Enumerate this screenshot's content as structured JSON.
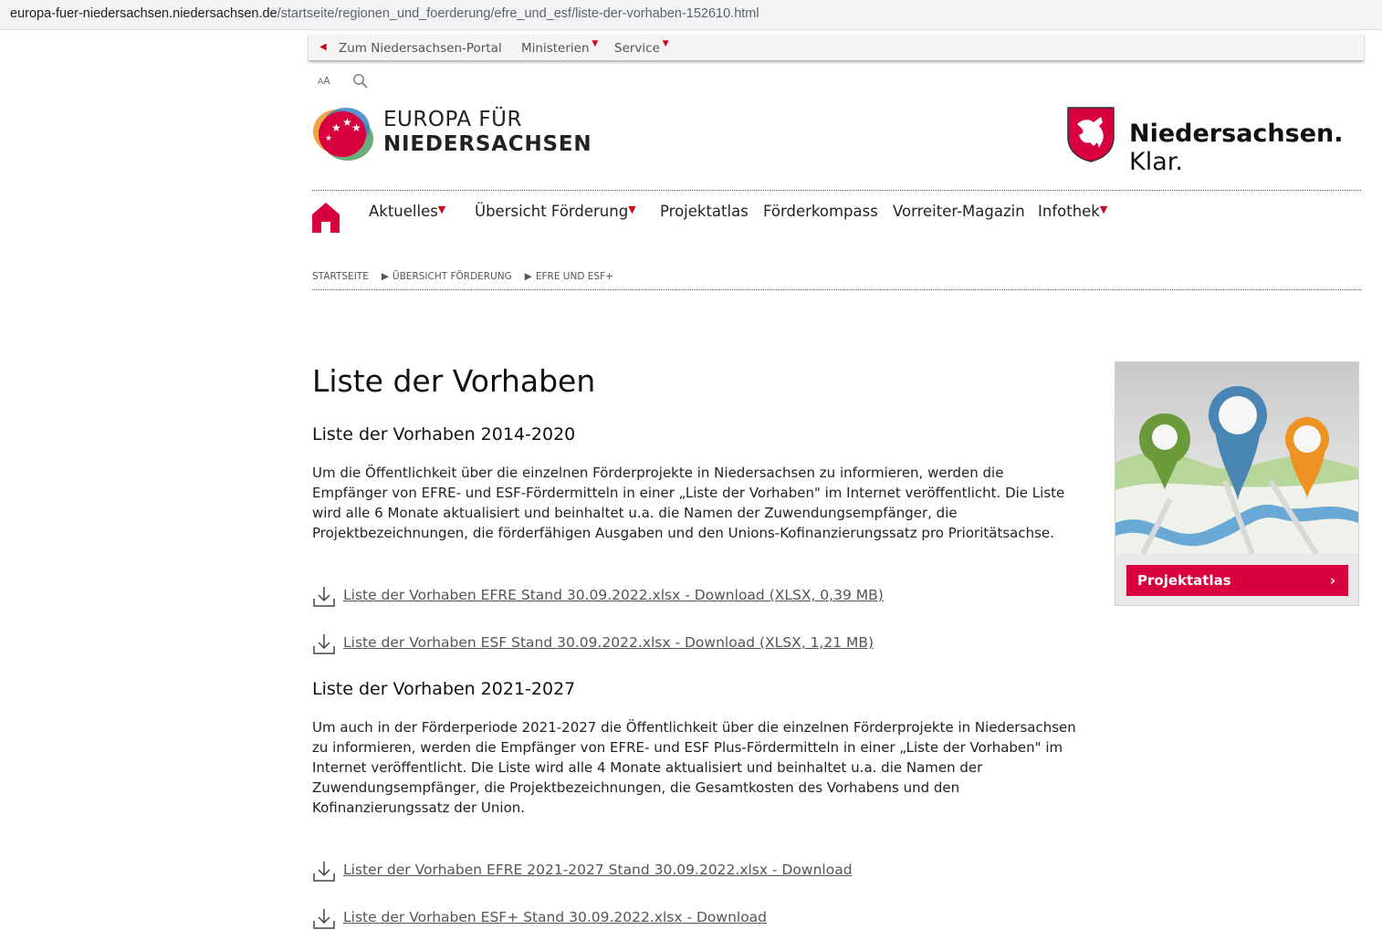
{
  "browser": {
    "url_host": "europa-fuer-niedersachsen.niedersachsen.de",
    "url_path": "/startseite/regionen_und_foerderung/efre_und_esf/liste-der-vorhaben-152610.html"
  },
  "topbar": {
    "portal_link": "Zum Niedersachsen-Portal",
    "ministerien": "Ministerien",
    "service": "Service"
  },
  "tools": {
    "font_size_label": "AA"
  },
  "eu_logo": {
    "line1": "EUROPA FÜR",
    "line2": "NIEDERSACHSEN"
  },
  "ns_logo": {
    "bold": "Niedersachsen.",
    "light": "Klar."
  },
  "nav": {
    "items": [
      {
        "label": "Aktuelles",
        "has_menu": true
      },
      {
        "label": "Übersicht Förderung",
        "has_menu": true
      },
      {
        "label": "Projektatlas",
        "has_menu": false
      },
      {
        "label": "Förderkompass",
        "has_menu": false
      },
      {
        "label": "Vorreiter-Magazin",
        "has_menu": false
      },
      {
        "label": "Infothek",
        "has_menu": true
      }
    ]
  },
  "breadcrumb": [
    "STARTSEITE",
    "ÜBERSICHT FÖRDERUNG",
    "EFRE UND ESF+"
  ],
  "main": {
    "title": "Liste der Vorhaben",
    "sections": [
      {
        "heading": "Liste der Vorhaben 2014-2020",
        "paragraph_lines": [
          "Um die Öffentlichkeit über die einzelnen Förderprojekte in Niedersachsen zu informieren, werden die",
          "Empfänger von EFRE- und ESF-Fördermitteln in einer „Liste der Vorhaben\" im Internet veröffentlicht. Die Liste",
          "wird alle 6 Monate aktualisiert und beinhaltet u.a. die Namen der Zuwendungsempfänger, die",
          "Projektbezeichnungen, die förderfähigen Ausgaben und den Unions-Kofinanzierungssatz pro Prioritätsachse."
        ],
        "downloads": [
          "Liste der Vorhaben EFRE Stand 30.09.2022.xlsx - Download (XLSX, 0,39 MB)",
          "Liste der Vorhaben ESF Stand 30.09.2022.xlsx - Download (XLSX, 1,21 MB)"
        ]
      },
      {
        "heading": "Liste der Vorhaben 2021-2027",
        "paragraph_lines": [
          "Um auch in der Förderperiode 2021-2027 die Öffentlichkeit über die einzelnen Förderprojekte in Niedersachsen",
          "zu informieren, werden die Empfänger von EFRE- und ESF Plus-Fördermitteln in einer „Liste der Vorhaben\" im",
          "Internet veröffentlicht. Die Liste wird alle 4 Monate aktualisiert und beinhaltet u.a. die Namen der",
          "Zuwendungsempfänger, die Projektbezeichnungen, die Gesamtkosten des Vorhabens und den",
          "Kofinanzierungssatz der Union."
        ],
        "downloads": [
          "Lister der Vorhaben EFRE 2021-2027 Stand 30.09.2022.xlsx - Download",
          "Liste der Vorhaben ESF+ Stand 30.09.2022.xlsx - Download"
        ]
      }
    ]
  },
  "teaser": {
    "button_label": "Projektatlas",
    "button_arrow": "›"
  },
  "colors": {
    "accent_red": "#d9003f",
    "link_gray": "#555555"
  }
}
